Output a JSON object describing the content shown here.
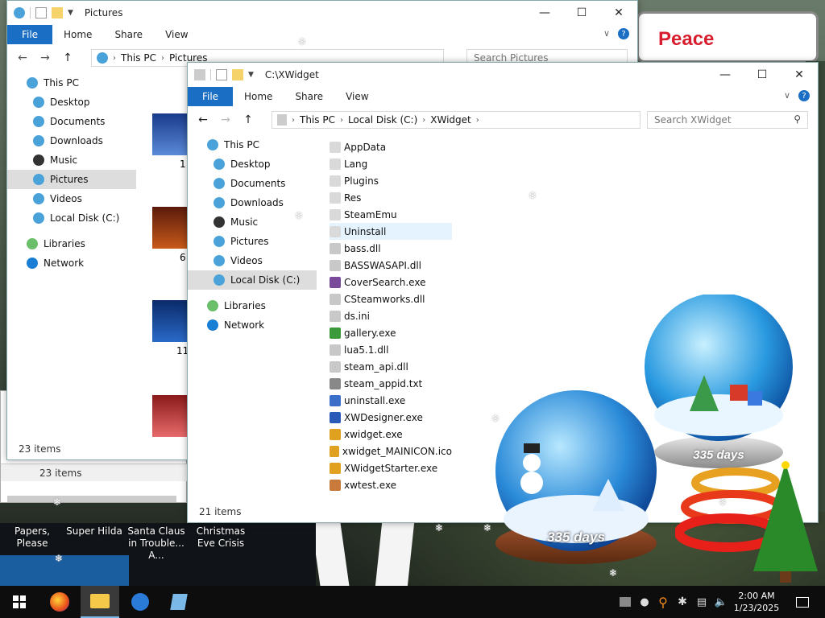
{
  "desktop": {
    "icon_labels": [
      "Papers, Please",
      "Super Hilda",
      "Santa Claus in Trouble... A...",
      "Christmas Eve Crisis"
    ],
    "banner_text": "Peace",
    "globe_small_label": "335 days",
    "globe_large_label": "335 days"
  },
  "back_window": {
    "title": "Pictures",
    "ribbon": {
      "file": "File",
      "tabs": [
        "Home",
        "Share",
        "View"
      ]
    },
    "address": {
      "crumbs": [
        "This PC",
        "Pictures"
      ]
    },
    "search_placeholder": "Search Pictures",
    "nav": [
      {
        "label": "This PC",
        "indent": false,
        "selected": false,
        "color": "#4aa3d8"
      },
      {
        "label": "Desktop",
        "indent": true,
        "selected": false,
        "color": "#4aa3d8"
      },
      {
        "label": "Documents",
        "indent": true,
        "selected": false,
        "color": "#4aa3d8"
      },
      {
        "label": "Downloads",
        "indent": true,
        "selected": false,
        "color": "#4aa3d8"
      },
      {
        "label": "Music",
        "indent": true,
        "selected": false,
        "color": "#333"
      },
      {
        "label": "Pictures",
        "indent": true,
        "selected": true,
        "color": "#4aa3d8"
      },
      {
        "label": "Videos",
        "indent": true,
        "selected": false,
        "color": "#4aa3d8"
      },
      {
        "label": "Local Disk (C:)",
        "indent": true,
        "selected": false,
        "color": "#4aa3d8"
      },
      {
        "label": "Libraries",
        "indent": false,
        "selected": false,
        "color": "#6bbf6b"
      },
      {
        "label": "Network",
        "indent": false,
        "selected": false,
        "color": "#1a7fd4"
      }
    ],
    "thumb_labels": [
      "1",
      "6",
      "11",
      ""
    ],
    "status": "23 items"
  },
  "behind_status": "23 items",
  "front_window": {
    "title": "C:\\XWidget",
    "ribbon": {
      "file": "File",
      "tabs": [
        "Home",
        "Share",
        "View"
      ]
    },
    "address": {
      "crumbs": [
        "This PC",
        "Local Disk (C:)",
        "XWidget"
      ]
    },
    "search_placeholder": "Search XWidget",
    "nav": [
      {
        "label": "This PC",
        "indent": false,
        "selected": false,
        "color": "#4aa3d8"
      },
      {
        "label": "Desktop",
        "indent": true,
        "selected": false,
        "color": "#4aa3d8"
      },
      {
        "label": "Documents",
        "indent": true,
        "selected": false,
        "color": "#4aa3d8"
      },
      {
        "label": "Downloads",
        "indent": true,
        "selected": false,
        "color": "#4aa3d8"
      },
      {
        "label": "Music",
        "indent": true,
        "selected": false,
        "color": "#333"
      },
      {
        "label": "Pictures",
        "indent": true,
        "selected": false,
        "color": "#4aa3d8"
      },
      {
        "label": "Videos",
        "indent": true,
        "selected": false,
        "color": "#4aa3d8"
      },
      {
        "label": "Local Disk (C:)",
        "indent": true,
        "selected": true,
        "color": "#4aa3d8"
      },
      {
        "label": "Libraries",
        "indent": false,
        "selected": false,
        "color": "#6bbf6b"
      },
      {
        "label": "Network",
        "indent": false,
        "selected": false,
        "color": "#1a7fd4"
      }
    ],
    "files": [
      {
        "name": "AppData",
        "icon": "folder-icon",
        "color": "#d9d9d9",
        "hover": false
      },
      {
        "name": "Lang",
        "icon": "folder-icon",
        "color": "#d9d9d9",
        "hover": false
      },
      {
        "name": "Plugins",
        "icon": "folder-icon",
        "color": "#d9d9d9",
        "hover": false
      },
      {
        "name": "Res",
        "icon": "folder-icon",
        "color": "#d9d9d9",
        "hover": false
      },
      {
        "name": "SteamEmu",
        "icon": "folder-icon",
        "color": "#d9d9d9",
        "hover": false
      },
      {
        "name": "Uninstall",
        "icon": "folder-icon",
        "color": "#d9d9d9",
        "hover": true
      },
      {
        "name": "bass.dll",
        "icon": "dll-icon",
        "color": "#c8c8c8",
        "hover": false
      },
      {
        "name": "BASSWASAPI.dll",
        "icon": "dll-icon",
        "color": "#c8c8c8",
        "hover": false
      },
      {
        "name": "CoverSearch.exe",
        "icon": "app-icon",
        "color": "#7a4a9a",
        "hover": false
      },
      {
        "name": "CSteamworks.dll",
        "icon": "dll-icon",
        "color": "#c8c8c8",
        "hover": false
      },
      {
        "name": "ds.ini",
        "icon": "ini-icon",
        "color": "#c8c8c8",
        "hover": false
      },
      {
        "name": "gallery.exe",
        "icon": "app-icon",
        "color": "#3a9a3a",
        "hover": false
      },
      {
        "name": "lua5.1.dll",
        "icon": "dll-icon",
        "color": "#c8c8c8",
        "hover": false
      },
      {
        "name": "steam_api.dll",
        "icon": "dll-icon",
        "color": "#c8c8c8",
        "hover": false
      },
      {
        "name": "steam_appid.txt",
        "icon": "text-icon",
        "color": "#888888",
        "hover": false
      },
      {
        "name": "uninstall.exe",
        "icon": "app-icon",
        "color": "#3a6ec8",
        "hover": false
      },
      {
        "name": "XWDesigner.exe",
        "icon": "app-icon",
        "color": "#2a5ab8",
        "hover": false
      },
      {
        "name": "xwidget.exe",
        "icon": "app-icon",
        "color": "#e0a020",
        "hover": false
      },
      {
        "name": "xwidget_MAINICON.ico",
        "icon": "app-icon",
        "color": "#e0a020",
        "hover": false
      },
      {
        "name": "XWidgetStarter.exe",
        "icon": "app-icon",
        "color": "#e0a020",
        "hover": false
      },
      {
        "name": "xwtest.exe",
        "icon": "app-icon",
        "color": "#c87a3a",
        "hover": false
      }
    ],
    "status": "21 items"
  },
  "taskbar": {
    "time": "2:00 AM",
    "date": "1/23/2025",
    "accent": "#1a6fc4"
  }
}
